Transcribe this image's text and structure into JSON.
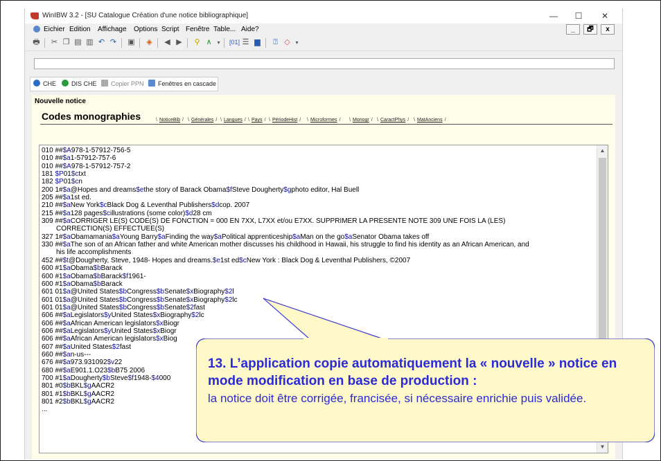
{
  "window": {
    "title": "WinIBW 3.2 - [SU Catalogue Création d'une notice bibliographique]",
    "minimize": "—",
    "maximize": "☐",
    "close": "✕"
  },
  "menu": {
    "items": [
      "Eichier",
      "Edition",
      "Affichage",
      "Options",
      "Script",
      "Fenêtre",
      "Table...",
      "Aide?"
    ],
    "mdi_min": "_",
    "mdi_restore": "🗗",
    "mdi_close": "x"
  },
  "linkbar": {
    "che": "CHE",
    "dis_che": "DIS CHE",
    "copier_ppn": "Copier PPN",
    "fenetres": "Fenêtres en cascade"
  },
  "doc": {
    "nouvelle_notice": "Nouvelle notice",
    "codes_title": "Codes monographies",
    "tabs": [
      "NoticeBib",
      "Générales",
      "Langues",
      "Pays",
      "PériodeHist",
      "Microformes",
      "Monogr",
      "CaractPhys",
      "MatAnciens"
    ]
  },
  "notice_lines": [
    {
      "text": "010 ##$A978-1-57912-756-5"
    },
    {
      "text": "010 ##$a1-57912-757-6"
    },
    {
      "text": "010 ##$A978-1-57912-757-2"
    },
    {
      "text": "181 $P01$ctxt"
    },
    {
      "text": "182 $P01$cn"
    },
    {
      "text": "200 1#$a@Hopes and dreams$ethe story of Barack Obama$fSteve Dougherty$gphoto editor, Hal Buell"
    },
    {
      "text": "205 ##$a1st ed."
    },
    {
      "text": "210 ##$aNew York$cBlack Dog & Leventhal Publishers$dcop. 2007"
    },
    {
      "text": "215 ##$a128 pages$cillustrations (some color)$d28 cm"
    },
    {
      "text": "309 ##$aCORRIGER LE(S) CODE(S) DE FONCTION = 000 EN 7XX, L7XX et/ou E7XX. SUPPRIMER LA PRESENTE NOTE 309 UNE FOIS LA (LES)"
    },
    {
      "text": "CORRECTION(S) EFFECTUEE(S)",
      "indent": true
    },
    {
      "text": "327 1#$aObamamania$aYoung Barry$aFinding the way$aPolitical apprenticeship$aMan on the go$aSenator Obama takes off"
    },
    {
      "text": "330 ##$aThe son of an African father and white American mother discusses his childhood in Hawaii, his struggle to find his identity as an African American, and"
    },
    {
      "text": "his life accomplishments",
      "indent": true
    },
    {
      "text": "452 ##$t@Dougherty, Steve, 1948- Hopes and dreams.$e1st ed$cNew York : Black Dog & Leventhal Publishers, ©2007"
    },
    {
      "text": "600 #1$aObama$bBarack"
    },
    {
      "text": "600 #1$aObama$bBarack$f1961-"
    },
    {
      "text": "600 #1$aObama$bBarack"
    },
    {
      "text": "601 01$a@United States$bCongress$bSenate$xBiography$2l"
    },
    {
      "text": "601 01$a@United States$bCongress$bSenate$xBiography$2lc"
    },
    {
      "text": "601 01$a@United States$bCongress$bSenate$2fast"
    },
    {
      "text": "606 ##$aLegislators$yUnited States$xBiography$2lc"
    },
    {
      "text": "606 ##$aAfrican American legislators$xBiogr"
    },
    {
      "text": "606 ##$aLegislators$yUnited States$xBiogr"
    },
    {
      "text": "606 ##$aAfrican American legislators$xBiog"
    },
    {
      "text": "607 ##$aUnited States$2fast"
    },
    {
      "text": "660 ##$an-us---"
    },
    {
      "text": "676 ##$a973.931092$v22"
    },
    {
      "text": "680 ##$aE901.1.O23$bB75 2006"
    },
    {
      "text": "700 #1$aDougherty$bSteve$f1948-$4000"
    },
    {
      "text": "801 #0$bBKL$gAACR2"
    },
    {
      "text": "801 #1$bBKL$gAACR2"
    },
    {
      "text": "801 #2$bBKL$gAACR2"
    },
    {
      "text": "..."
    }
  ],
  "callout": {
    "bold": "13. L’application copie automatiquement la « nouvelle » notice en mode modification en base de production :",
    "normal": "la notice doit être corrigée, francisée, si nécessaire enrichie puis validée."
  },
  "colors": {
    "subfield": "#1010a0",
    "callout_text": "#2b2bd6",
    "callout_fill": "#fff8c8",
    "callout_stroke": "#3b3bd0",
    "doc_bg": "#fdfde9"
  }
}
